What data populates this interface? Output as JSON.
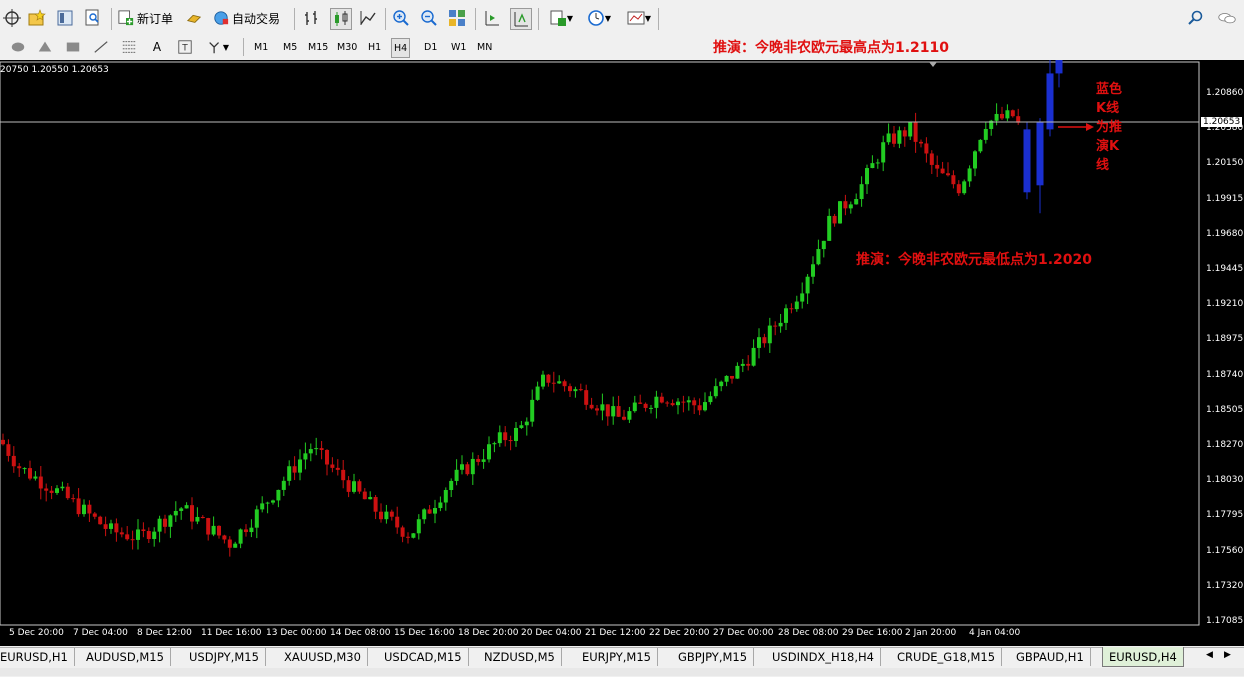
{
  "toolbar": {
    "new_order": "新订单",
    "auto_trading": "自动交易",
    "timeframes": [
      "M1",
      "M5",
      "M15",
      "M30",
      "H1",
      "H4",
      "D1",
      "W1",
      "MN"
    ],
    "active_timeframe": "H4"
  },
  "chart": {
    "ohlc_text": "20750 1.20550 1.20653",
    "current_price": "1.20653",
    "price_labels": [
      "1.20860",
      "1.20380",
      "1.20150",
      "1.19915",
      "1.19680",
      "1.19445",
      "1.19210",
      "1.18975",
      "1.18740",
      "1.18505",
      "1.18270",
      "1.18030",
      "1.17795",
      "1.17560",
      "1.17320",
      "1.17085"
    ],
    "time_labels": [
      "5 Dec 20:00",
      "7 Dec 04:00",
      "8 Dec 12:00",
      "11 Dec 16:00",
      "13 Dec 00:00",
      "14 Dec 08:00",
      "15 Dec 16:00",
      "18 Dec 20:00",
      "20 Dec 04:00",
      "21 Dec 12:00",
      "22 Dec 20:00",
      "27 Dec 00:00",
      "28 Dec 08:00",
      "29 Dec 16:00",
      "2 Jan 20:00",
      "4 Jan 04:00"
    ],
    "colors": {
      "up": "#22cc22",
      "down": "#cc1111",
      "projected": "#1a2fd0",
      "background": "#000000",
      "annotation": "#e01010"
    }
  },
  "annotations": {
    "high_note": "推演：今晚非农欧元最高点为1.2110",
    "low_note": "推演：今晚非农欧元最低点为1.2020",
    "blue_note_lines": [
      "蓝色",
      "K线",
      "为推",
      "演K",
      "线"
    ]
  },
  "tabs": {
    "items": [
      "EURUSD,H1",
      "AUDUSD,M15",
      "USDJPY,M15",
      "XAUUSD,M30",
      "USDCAD,M15",
      "NZDUSD,M5",
      "EURJPY,M15",
      "GBPJPY,M15",
      "USDINDX_H18,H4",
      "CRUDE_G18,M15",
      "GBPAUD,H1",
      "EURUSD,H4"
    ],
    "active": "EURUSD,H4"
  }
}
